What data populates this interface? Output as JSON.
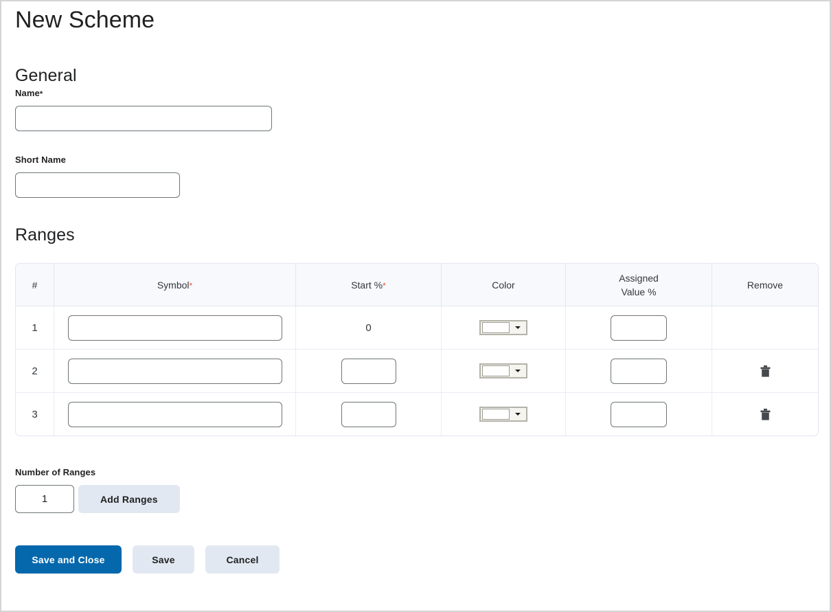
{
  "page": {
    "title": "New Scheme"
  },
  "general": {
    "heading": "General",
    "name": {
      "label": "Name",
      "required_marker": "*",
      "value": "",
      "placeholder": ""
    },
    "short_name": {
      "label": "Short Name",
      "value": "",
      "placeholder": ""
    }
  },
  "ranges": {
    "heading": "Ranges",
    "columns": [
      {
        "key": "index",
        "label": "#",
        "required_marker": ""
      },
      {
        "key": "symbol",
        "label": "Symbol",
        "required_marker": "*"
      },
      {
        "key": "start",
        "label": "Start %",
        "required_marker": "*"
      },
      {
        "key": "color",
        "label": "Color",
        "required_marker": ""
      },
      {
        "key": "assigned",
        "label_line1": "Assigned",
        "label_line2": "Value %",
        "required_marker": ""
      },
      {
        "key": "remove",
        "label": "Remove",
        "required_marker": ""
      }
    ],
    "rows": [
      {
        "index": "1",
        "symbol_value": "",
        "start_is_text": true,
        "start_text": "0",
        "start_value": "",
        "color_swatch": "#ffffff",
        "color_icon": "color-picker-dropdown",
        "assigned_value": "",
        "has_remove": false,
        "remove_icon": ""
      },
      {
        "index": "2",
        "symbol_value": "",
        "start_is_text": false,
        "start_text": "",
        "start_value": "",
        "color_swatch": "#ffffff",
        "color_icon": "color-picker-dropdown",
        "assigned_value": "",
        "has_remove": true,
        "remove_icon": "trash-icon"
      },
      {
        "index": "3",
        "symbol_value": "",
        "start_is_text": false,
        "start_text": "",
        "start_value": "",
        "color_swatch": "#ffffff",
        "color_icon": "color-picker-dropdown",
        "assigned_value": "",
        "has_remove": true,
        "remove_icon": "trash-icon"
      }
    ]
  },
  "controls": {
    "number_of_ranges_label": "Number of Ranges",
    "number_of_ranges_value": "1",
    "add_ranges_label": "Add Ranges"
  },
  "footer": {
    "save_and_close_label": "Save and Close",
    "save_label": "Save",
    "cancel_label": "Cancel"
  },
  "colors": {
    "primary_button": "#0568ad",
    "secondary_button": "#e2e8f1",
    "required_asterisk": "#e8503a",
    "table_header_bg": "#f8f9fd",
    "table_border": "#e2e6ef",
    "input_border": "#6e7477",
    "text": "#202122",
    "trash_icon": "#45494d",
    "page_border": "#d4d4d4"
  }
}
